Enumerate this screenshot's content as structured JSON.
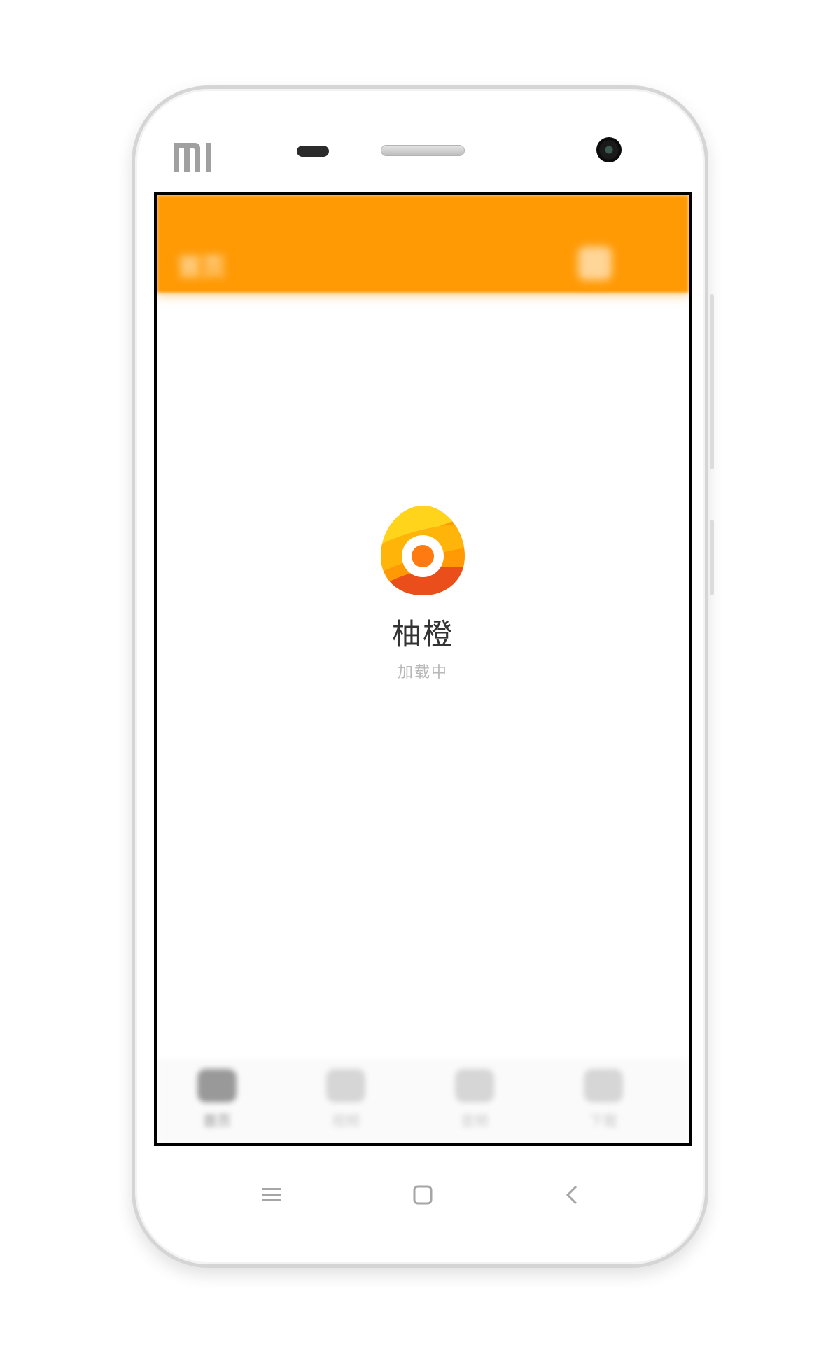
{
  "device": {
    "brand_logo_text": "MI",
    "nav_keys": {
      "menu_icon": "menu-icon",
      "home_icon": "home-square-icon",
      "back_icon": "chevron-left-icon"
    }
  },
  "app_bar": {
    "title": "首页",
    "right_icon": "calendar-icon",
    "color": "#ff9a05"
  },
  "splash": {
    "app_name": "柚橙",
    "status": "加载中",
    "logo_colors": [
      "#ffd41a",
      "#ff9a05",
      "#e94e1b"
    ]
  },
  "tabs": [
    {
      "label": "首页",
      "icon": "home-icon",
      "active": true
    },
    {
      "label": "视频",
      "icon": "play-icon",
      "active": false
    },
    {
      "label": "音频",
      "icon": "headphones-icon",
      "active": false
    },
    {
      "label": "下载",
      "icon": "cloud-download-icon",
      "active": false
    }
  ]
}
